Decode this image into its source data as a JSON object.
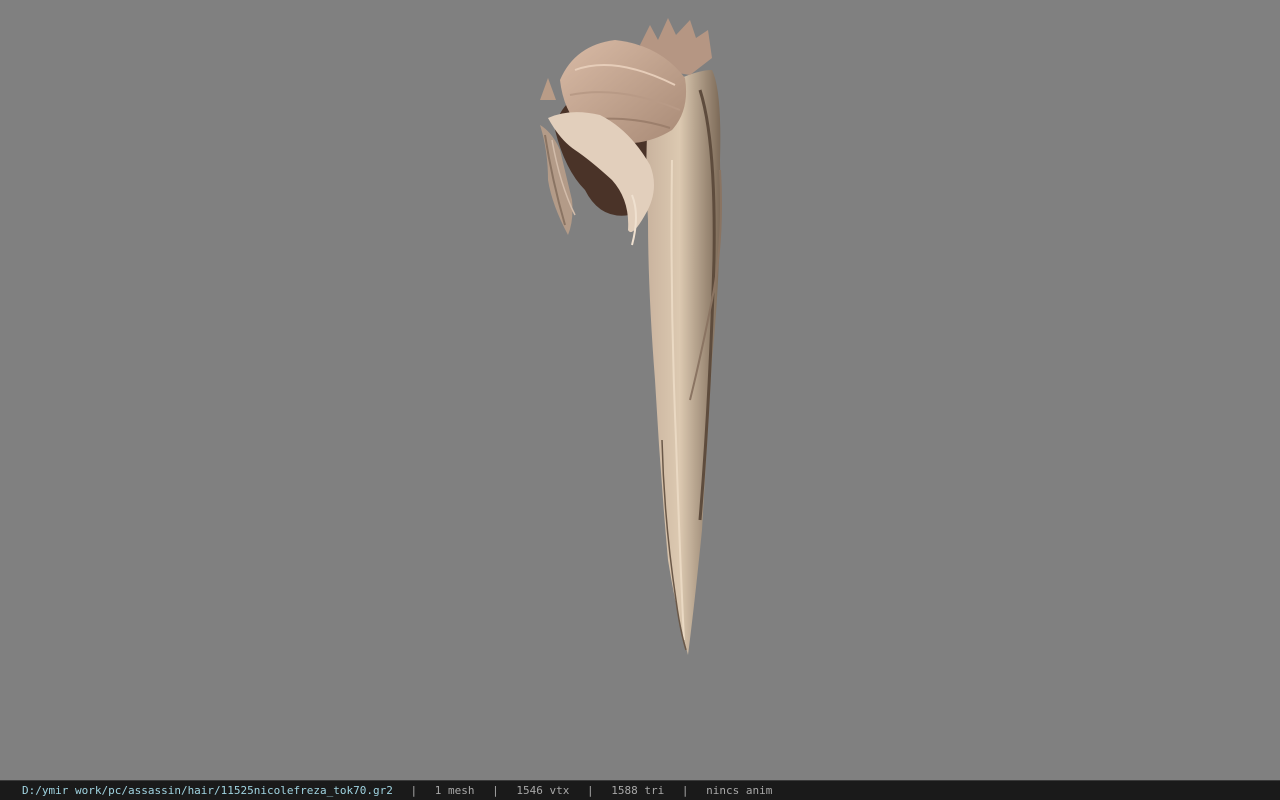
{
  "viewport": {
    "background_color": "#808080",
    "model_icon": "hair-mesh"
  },
  "statusbar": {
    "path": "D:/ymir work/pc/assassin/hair/11525nicolefreza_tok70.gr2",
    "separator": "|",
    "mesh_count": "1 mesh",
    "vertex_count": "1546 vtx",
    "triangle_count": "1588 tri",
    "anim_status": "nincs anim",
    "path_color": "#9fd3e0",
    "text_color": "#a8a8a8"
  }
}
